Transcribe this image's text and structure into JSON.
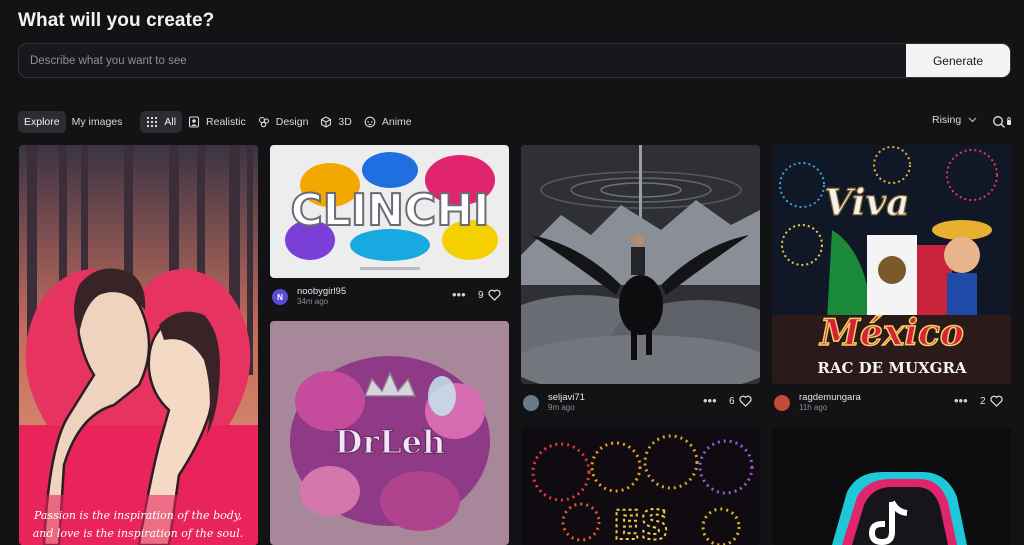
{
  "header": {
    "title": "What will you create?"
  },
  "prompt": {
    "placeholder": "Describe what you want to see",
    "generate_label": "Generate"
  },
  "tabs": [
    {
      "label": "Explore",
      "active": true
    },
    {
      "label": "My images",
      "active": false
    }
  ],
  "categories": [
    {
      "label": "All",
      "icon": "grid-icon",
      "active": true
    },
    {
      "label": "Realistic",
      "icon": "portrait-icon",
      "active": false
    },
    {
      "label": "Design",
      "icon": "palette-icon",
      "active": false
    },
    {
      "label": "3D",
      "icon": "cube-icon",
      "active": false
    },
    {
      "label": "Anime",
      "icon": "anime-face-icon",
      "active": false
    }
  ],
  "sort": {
    "label": "Rising"
  },
  "cards": [
    {
      "image": "couple-heart-illustration",
      "caption_line1": "Passion is the inspiration of the body,",
      "caption_line2": "and love is the inspiration of the soul."
    },
    {
      "image": "clinchi-3d-text",
      "art_text": "CLINCHI",
      "user": "noobygirl95",
      "avatar_initial": "N",
      "time": "34m ago",
      "likes": "9"
    },
    {
      "image": "drleh-purple-floral",
      "art_text": "DrLeh"
    },
    {
      "image": "black-pegasus-rider",
      "user": "seljavi71",
      "time": "9m ago",
      "likes": "6"
    },
    {
      "image": "fireworks-es",
      "art_text": "ES"
    },
    {
      "image": "viva-mexico-poster",
      "art_text_1": "Viva",
      "art_text_2": "México",
      "art_text_3": "RAC DE MUXGRA",
      "user": "ragdemungara",
      "time": "11h ago",
      "likes": "2"
    },
    {
      "image": "tiktok-logo"
    }
  ],
  "colors": {
    "background": "#131316",
    "accent_pink": "#e8245a",
    "generate_bg": "#f4f4f6"
  }
}
